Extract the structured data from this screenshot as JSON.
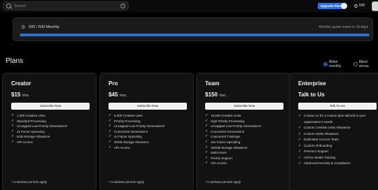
{
  "topbar": {
    "search_placeholder": "Search",
    "clear_label": "×",
    "upgrade_label": "Upgrade Plan",
    "credits": "500"
  },
  "quota": {
    "label": "500 / 500 Monthly",
    "reset_text": "Monthly quota resets in 15 days",
    "fill_fraction": 1.0,
    "accent": "#2d6dd4"
  },
  "plans": {
    "title": "Plans",
    "billing_monthly": "Billed monthly",
    "billing_annual": "Billed annua"
  },
  "cards": [
    {
      "name": "Creator",
      "price": "$15",
      "per": "/mo.",
      "button": "Subscribe Now",
      "features": [
        "1,500 Creative Units",
        "Standard Processing",
        "Uncapped Low Priority Generations*",
        "2x Factor Upscaling",
        "5GB Storage Allowance",
        "API Access"
      ],
      "footnote": "* Cooldown periods apply"
    },
    {
      "name": "Pro",
      "price": "$45",
      "per": "/mo.",
      "button": "Subscribe Now",
      "features": [
        "5,000 Creative Units",
        "Priority Processing",
        "Uncapped Low Priority Generations*",
        "Concurrent Generations",
        "4x Factor Upscaling",
        "50GB Storage Allowance",
        "API Access"
      ],
      "footnote": "* Cooldown periods apply"
    },
    {
      "name": "Team",
      "price": "$150",
      "per": "/mo.",
      "button": "Subscribe Now",
      "features": [
        "15,000 Creative Units",
        "High Priority Processing",
        "Uncapped Low Priority Generations*",
        "Concurrent Generations",
        "Concurrent Trainings",
        "16x Factor Upscaling",
        "100GB Storage Allowance",
        "Multi-Users",
        "Priority Support",
        "API Access"
      ],
      "footnote": "* Cooldown periods apply"
    },
    {
      "name": "Enterprise",
      "price": "Talk to Us",
      "per": "",
      "button": "Talk To Us!",
      "features": [
        "Contact us for a custom plan tailored to your organization's needs",
        "Custom Creative Units Allowance",
        "Custom Seats Allowance",
        "Dedicated Account Team",
        "Custom Onboarding",
        "Premium Support",
        "Ad-hoc Model Training",
        "Advanced Security & Compliance"
      ]
    }
  ]
}
